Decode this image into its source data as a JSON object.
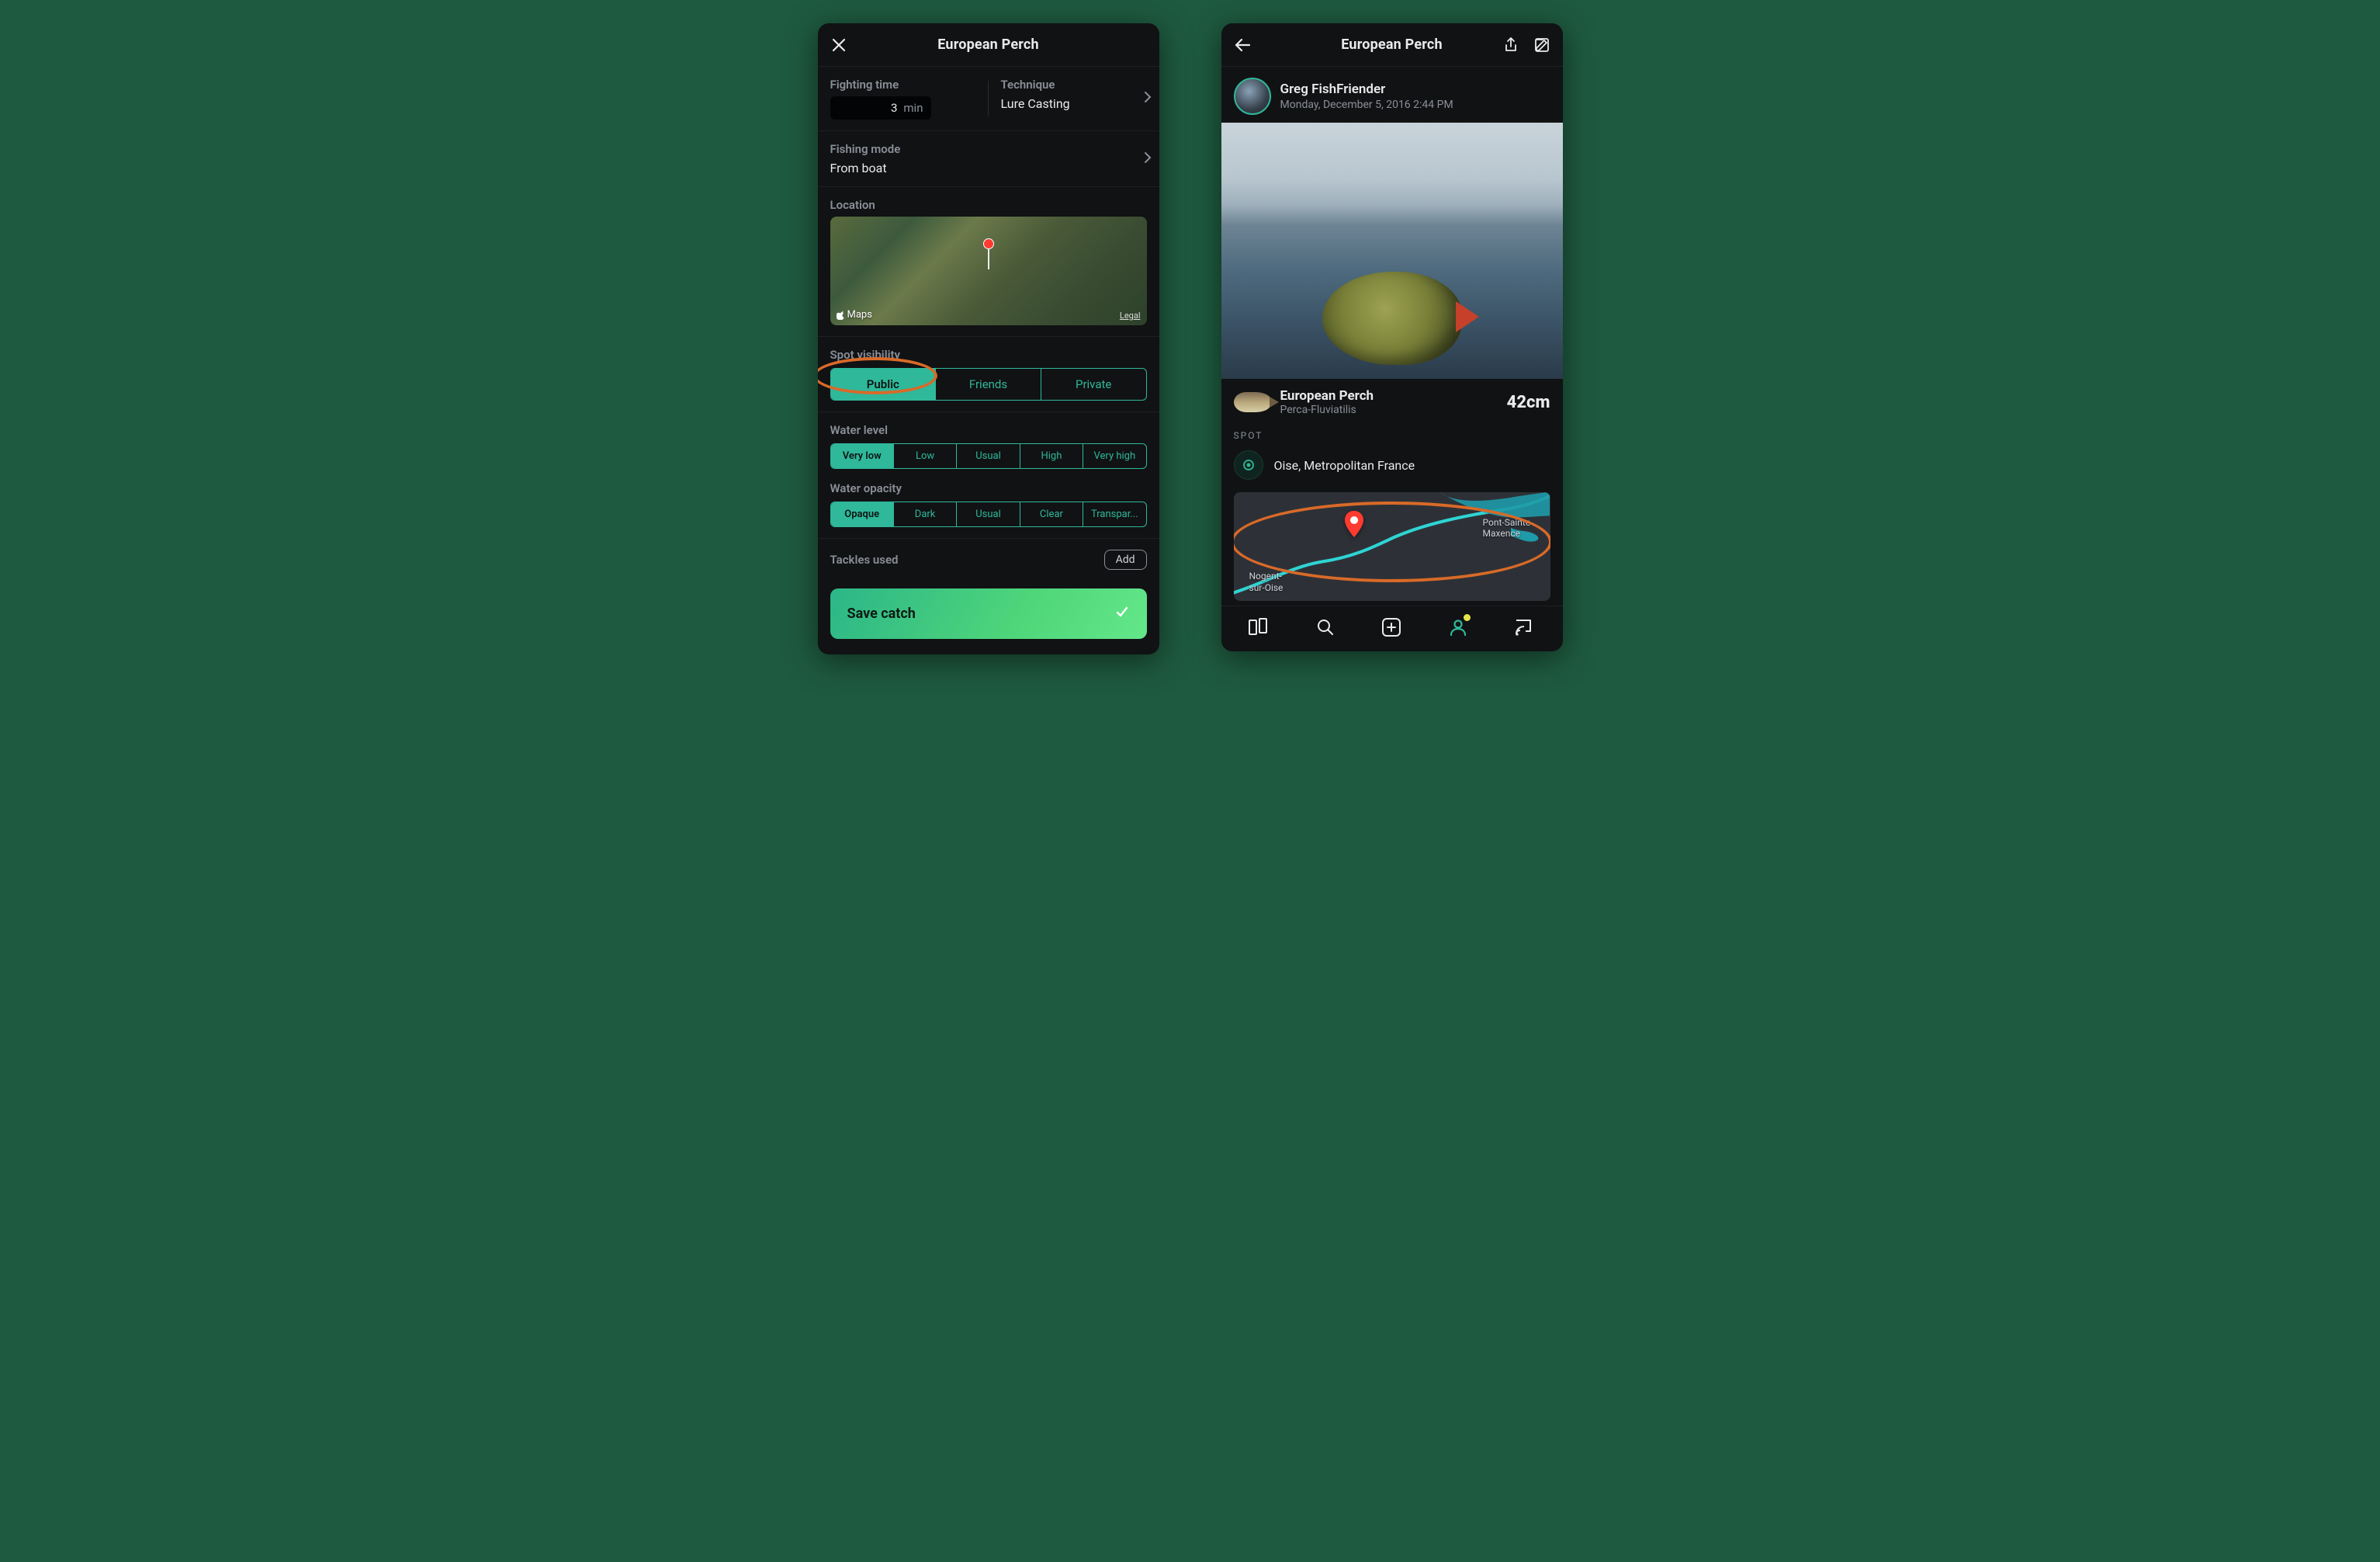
{
  "left": {
    "title": "European Perch",
    "fighting_time": {
      "label": "Fighting time",
      "value": "3",
      "unit": "min"
    },
    "technique": {
      "label": "Technique",
      "value": "Lure Casting"
    },
    "fishing_mode": {
      "label": "Fishing mode",
      "value": "From boat"
    },
    "location_label": "Location",
    "map": {
      "brand": "Maps",
      "legal": "Legal"
    },
    "spot_visibility": {
      "label": "Spot visibility",
      "options": [
        "Public",
        "Friends",
        "Private"
      ],
      "selected": 0
    },
    "water_level": {
      "label": "Water level",
      "options": [
        "Very low",
        "Low",
        "Usual",
        "High",
        "Very high"
      ],
      "selected": 0
    },
    "water_opacity": {
      "label": "Water opacity",
      "options": [
        "Opaque",
        "Dark",
        "Usual",
        "Clear",
        "Transpar..."
      ],
      "selected": 0
    },
    "tackles": {
      "label": "Tackles used",
      "add": "Add"
    },
    "save": "Save catch"
  },
  "right": {
    "title": "European Perch",
    "user": {
      "name": "Greg FishFriender",
      "date": "Monday, December 5, 2016 2:44 PM"
    },
    "species": {
      "name": "European Perch",
      "latin": "Perca-Fluviatilis",
      "size": "42cm"
    },
    "spot_label": "SPOT",
    "location": "Oise, Metropolitan France",
    "map_labels": {
      "a": "Pont-Sainte-\nMaxence",
      "b": "Nogent-\nsur-Oise"
    }
  }
}
